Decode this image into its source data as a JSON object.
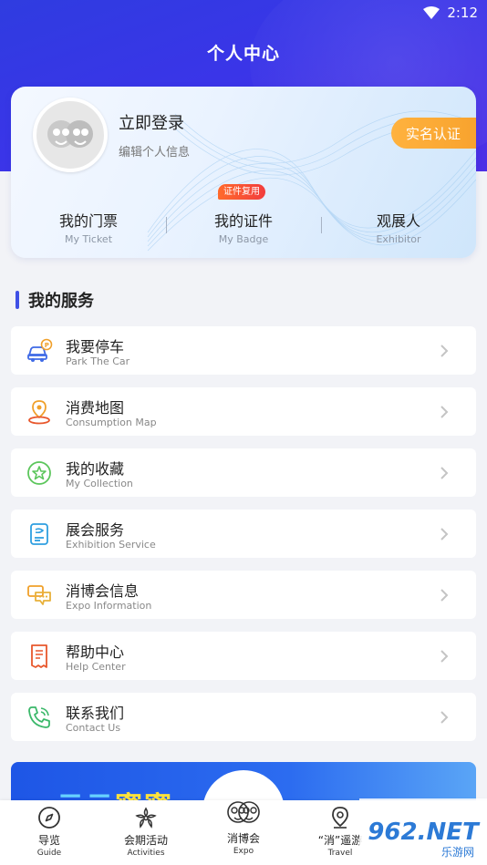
{
  "status_bar": {
    "time": "2:12"
  },
  "header": {
    "title": "个人中心"
  },
  "profile": {
    "login_title": "立即登录",
    "edit_info": "编辑个人信息",
    "verify_button": "实名认证",
    "stats": [
      {
        "title": "我的门票",
        "sub": "My Ticket"
      },
      {
        "title": "我的证件",
        "sub": "My Badge",
        "badge": "证件复用"
      },
      {
        "title": "观展人",
        "sub": "Exhibitor"
      }
    ]
  },
  "services": {
    "section_title": "我的服务",
    "items": [
      {
        "title": "我要停车",
        "sub": "Park The Car",
        "icon": "parking-car-icon"
      },
      {
        "title": "消费地图",
        "sub": "Consumption Map",
        "icon": "map-pin-icon"
      },
      {
        "title": "我的收藏",
        "sub": "My Collection",
        "icon": "star-icon"
      },
      {
        "title": "展会服务",
        "sub": "Exhibition Service",
        "icon": "exhibition-icon"
      },
      {
        "title": "消博会信息",
        "sub": "Expo Information",
        "icon": "chat-bubbles-icon"
      },
      {
        "title": "帮助中心",
        "sub": "Help Center",
        "icon": "receipt-icon"
      },
      {
        "title": "联系我们",
        "sub": "Contact Us",
        "icon": "phone-icon"
      }
    ]
  },
  "banner": {
    "text_part1": "云云",
    "text_part2": "蜜蜜"
  },
  "bottom_nav": [
    {
      "label": "导览",
      "sub": "Guide"
    },
    {
      "label": "会期活动",
      "sub": "Activities"
    },
    {
      "label": "消博会",
      "sub": "Expo"
    },
    {
      "label": "“消”遥游",
      "sub": "Travel"
    }
  ],
  "watermark": {
    "text": "962.NET",
    "sub": "乐游网"
  },
  "colors": {
    "primary": "#3a3ee6",
    "accent_orange": "#f7a12c",
    "badge_red": "#f23d3d",
    "page_bg": "#f2f3f7"
  }
}
